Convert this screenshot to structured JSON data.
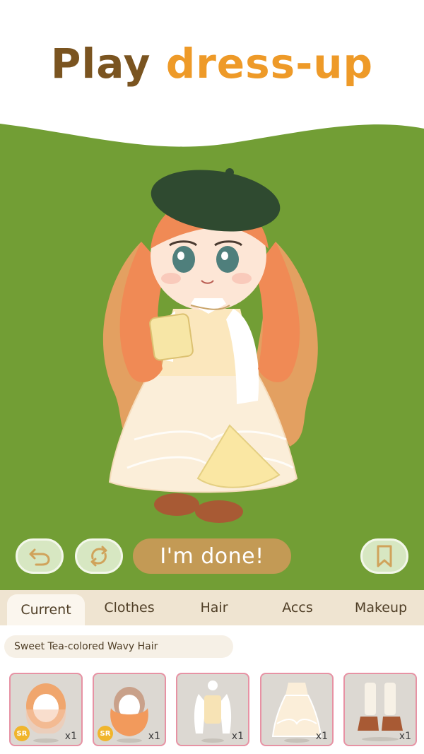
{
  "header": {
    "title_word1": "Play",
    "title_word2": "dress-up"
  },
  "colors": {
    "stage_green": "#729e35",
    "title_brown": "#7a5420",
    "title_orange": "#ee9a28",
    "done_button": "#c39a55",
    "control_button": "#d7e7c2",
    "card_border": "#e792a4",
    "badge_yellow": "#f0b52c"
  },
  "controls": {
    "undo_icon": "undo-arrow-icon",
    "shuffle_icon": "shuffle-arrows-icon",
    "done_label": "I'm done!",
    "save_icon": "bookmark-icon"
  },
  "tabs": [
    {
      "label": "Current",
      "active": true
    },
    {
      "label": "Clothes",
      "active": false
    },
    {
      "label": "Hair",
      "active": false
    },
    {
      "label": "Accs",
      "active": false
    },
    {
      "label": "Makeup",
      "active": false
    }
  ],
  "selected_item": {
    "name": "Sweet Tea-colored Wavy Hair"
  },
  "items": [
    {
      "badge": "SR",
      "quantity": "x1",
      "icon": "hair-front-icon"
    },
    {
      "badge": "SR",
      "quantity": "x1",
      "icon": "hair-back-icon"
    },
    {
      "badge": "",
      "quantity": "x1",
      "icon": "blouse-icon"
    },
    {
      "badge": "",
      "quantity": "x1",
      "icon": "lace-dress-icon"
    },
    {
      "badge": "",
      "quantity": "x1",
      "icon": "boots-icon"
    }
  ]
}
